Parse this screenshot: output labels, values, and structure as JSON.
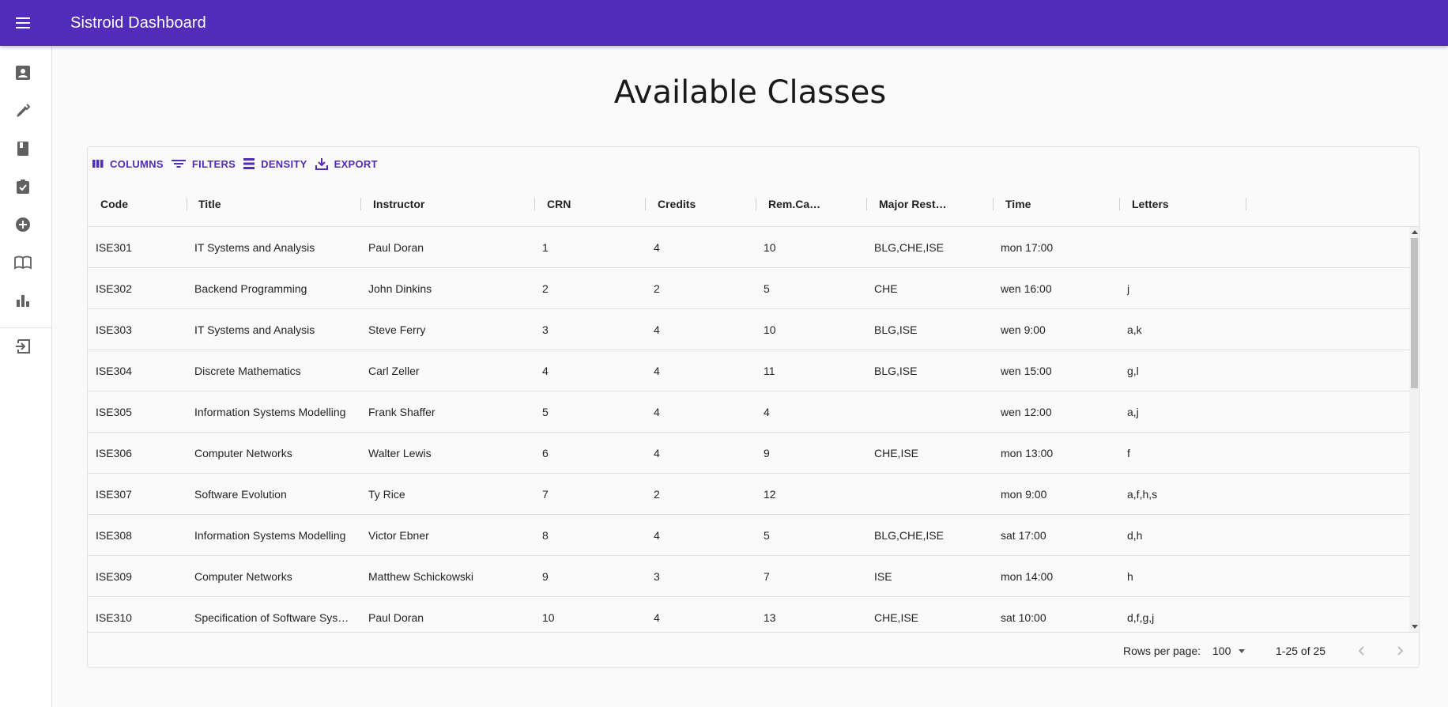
{
  "app": {
    "title": "Sistroid Dashboard"
  },
  "sidebar": {
    "items": [
      {
        "icon": "person-card-icon"
      },
      {
        "icon": "eyedropper-icon"
      },
      {
        "icon": "book-icon"
      },
      {
        "icon": "assignment-check-icon"
      },
      {
        "icon": "add-circle-icon"
      },
      {
        "icon": "open-book-icon"
      },
      {
        "icon": "bar-chart-icon"
      },
      {
        "icon": "logout-icon"
      }
    ]
  },
  "page": {
    "title": "Available Classes"
  },
  "toolbar": {
    "columns": "Columns",
    "filters": "Filters",
    "density": "Density",
    "export": "Export"
  },
  "table": {
    "headers": [
      "Code",
      "Title",
      "Instructor",
      "CRN",
      "Credits",
      "Rem.Ca…",
      "Major Rest…",
      "Time",
      "Letters"
    ],
    "rows": [
      [
        "ISE301",
        "IT Systems and Analysis",
        "Paul Doran",
        "1",
        "4",
        "10",
        "BLG,CHE,ISE",
        "mon 17:00",
        ""
      ],
      [
        "ISE302",
        "Backend Programming",
        "John Dinkins",
        "2",
        "2",
        "5",
        "CHE",
        "wen 16:00",
        "j"
      ],
      [
        "ISE303",
        "IT Systems and Analysis",
        "Steve Ferry",
        "3",
        "4",
        "10",
        "BLG,ISE",
        "wen 9:00",
        "a,k"
      ],
      [
        "ISE304",
        "Discrete Mathematics",
        "Carl Zeller",
        "4",
        "4",
        "11",
        "BLG,ISE",
        "wen 15:00",
        "g,l"
      ],
      [
        "ISE305",
        "Information Systems Modelling",
        "Frank Shaffer",
        "5",
        "4",
        "4",
        "",
        "wen 12:00",
        "a,j"
      ],
      [
        "ISE306",
        "Computer Networks",
        "Walter Lewis",
        "6",
        "4",
        "9",
        "CHE,ISE",
        "mon 13:00",
        "f"
      ],
      [
        "ISE307",
        "Software Evolution",
        "Ty Rice",
        "7",
        "2",
        "12",
        "",
        "mon 9:00",
        "a,f,h,s"
      ],
      [
        "ISE308",
        "Information Systems Modelling",
        "Victor Ebner",
        "8",
        "4",
        "5",
        "BLG,CHE,ISE",
        "sat 17:00",
        "d,h"
      ],
      [
        "ISE309",
        "Computer Networks",
        "Matthew Schickowski",
        "9",
        "3",
        "7",
        "ISE",
        "mon 14:00",
        "h"
      ],
      [
        "ISE310",
        "Specification of Software Sys…",
        "Paul Doran",
        "10",
        "4",
        "13",
        "CHE,ISE",
        "sat 10:00",
        "d,f,g,j"
      ]
    ]
  },
  "footer": {
    "rows_per_page_label": "Rows per page:",
    "rows_per_page_value": "100",
    "range": "1-25 of 25"
  },
  "colors": {
    "primary": "#512bb9",
    "sidebar_icon": "#616161"
  }
}
